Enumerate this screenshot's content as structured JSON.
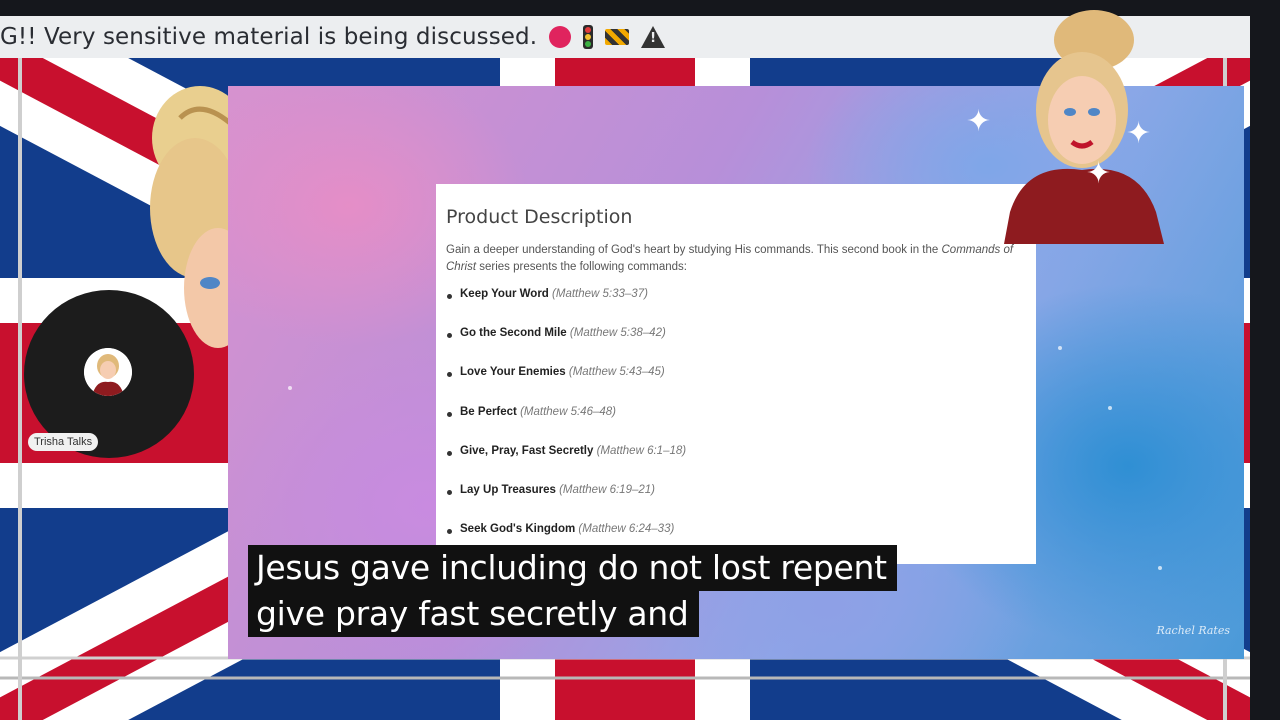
{
  "ticker": {
    "text": "G!! Very sensitive material is being discussed.",
    "icons": [
      "stop-icon",
      "traffic-light-icon",
      "construction-barrier-icon",
      "warning-icon"
    ]
  },
  "product": {
    "heading": "Product Description",
    "intro_before": "Gain a deeper understanding of God's heart by studying His commands. This second book in the ",
    "intro_series": "Commands of Christ",
    "intro_after": " series presents the following commands:",
    "commands": [
      {
        "name": "Keep Your Word",
        "ref": "(Matthew 5:33–37)"
      },
      {
        "name": "Go the Second Mile",
        "ref": "(Matthew 5:38–42)"
      },
      {
        "name": "Love Your Enemies",
        "ref": "(Matthew 5:43–45)"
      },
      {
        "name": "Be Perfect",
        "ref": "(Matthew 5:46–48)"
      },
      {
        "name": "Give, Pray, Fast Secretly",
        "ref": "(Matthew 6:1–18)"
      },
      {
        "name": "Lay Up Treasures",
        "ref": "(Matthew 6:19–21)"
      },
      {
        "name": "Seek God's Kingdom",
        "ref": "(Matthew 6:24–33)"
      }
    ]
  },
  "subtitles": {
    "line1": "Jesus gave including do not lost repent",
    "line2": "give pray fast secretly and"
  },
  "streamer": {
    "name": "Trisha Talks"
  },
  "watermark": "Rachel Rates",
  "colors": {
    "flag_blue": "#123d8c",
    "flag_red": "#c8102e",
    "stop": "#e0245e"
  }
}
